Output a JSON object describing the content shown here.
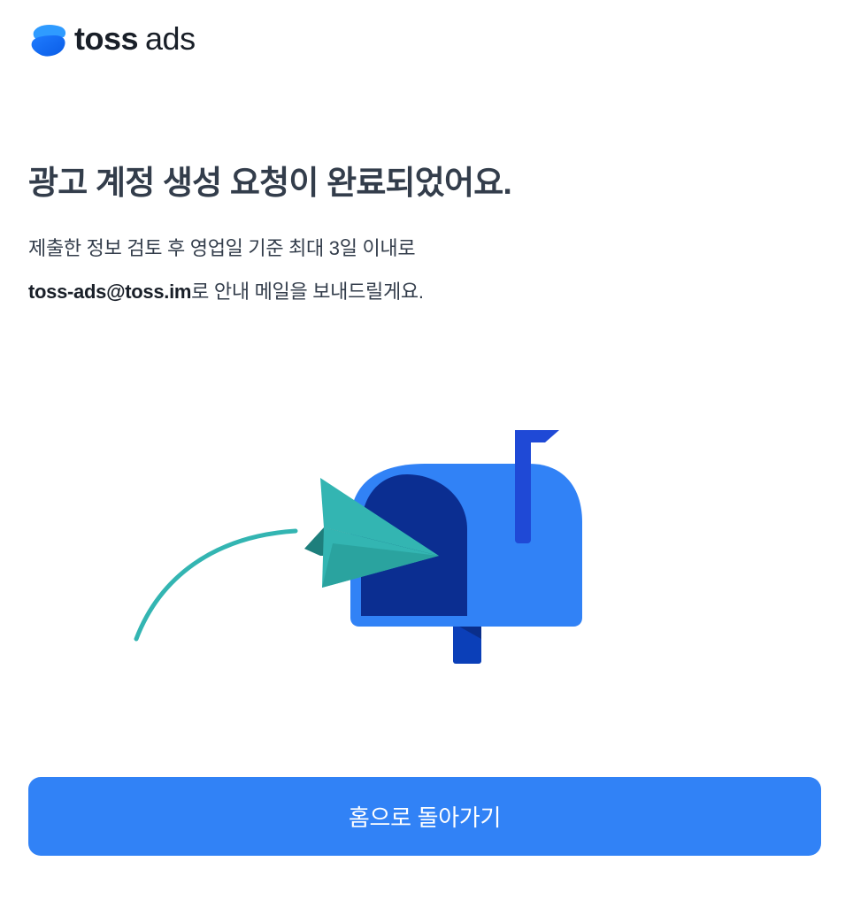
{
  "brand": {
    "name_bold": "toss",
    "name_light": "ads",
    "icon": "toss-logo-icon",
    "color": "#3182f6"
  },
  "main": {
    "title": "광고 계정 생성 요청이 완료되었어요.",
    "description_line1": "제출한 정보 검토 후 영업일 기준 최대 3일 이내로",
    "email": "toss-ads@toss.im",
    "description_line2_suffix": "로 안내 메일을 보내드릴게요."
  },
  "illustration": {
    "icon": "mailbox-with-paper-plane-illustration"
  },
  "actions": {
    "home_button_label": "홈으로 돌아가기"
  },
  "colors": {
    "accent": "#3182f6",
    "text_primary": "#191f28",
    "text_secondary": "#333d4b",
    "mailbox_dark": "#0b2e91",
    "plane_teal": "#33b5b2"
  }
}
